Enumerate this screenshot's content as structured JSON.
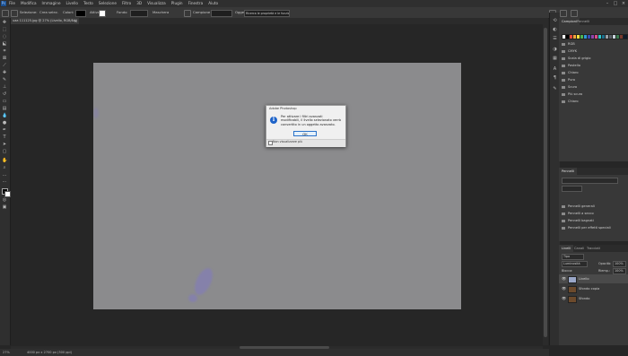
{
  "menubar": {
    "items": [
      "File",
      "Modifica",
      "Immagine",
      "Livello",
      "Testo",
      "Selezione",
      "Filtro",
      "3D",
      "Visualizza",
      "Plugin",
      "Finestra",
      "Aiuto"
    ],
    "logo": "Ps"
  },
  "options_bar": {
    "label_1": "Selezione:",
    "value_1": "Crea selez.",
    "label_2": "Colori:",
    "label_3": "Attiva",
    "label_4": "Fondo",
    "label_5": "Maschera",
    "label_6": "Campione",
    "label_7": "Oggetto",
    "search_text": "Ricerca le proprietà e le funzioni"
  },
  "document_tab": {
    "title": "uaa 111125.jpg @ 27% (Livello, RGB/8#)",
    "close": "×"
  },
  "dialog": {
    "title": "Adobe Photoshop",
    "message": "Per attivare i filtri avanzati modificabili, il livello selezionato verrà convertito in un oggetto avanzato.",
    "ok_label": "OK",
    "checkbox_label": "Non visualizzare più"
  },
  "panel_top": {
    "tabs": [
      "Campioni",
      "Pennelli"
    ],
    "folders": [
      "RGB",
      "CMYK",
      "Scala di grigio",
      "Pastello",
      "Chiaro",
      "Puro",
      "Scuro",
      "Più scuro",
      "Chiaro"
    ],
    "swatch_colors": [
      "#ffffff",
      "#000000",
      "#e84b3a",
      "#f2a33a",
      "#f5e33b",
      "#4fb24e",
      "#2e9ad6",
      "#3a4bb5",
      "#8e44ad",
      "#d94c8c",
      "#2fc6c8",
      "#1c6e8c",
      "#9aa0a6",
      "#5a5f66",
      "#c8d4dc",
      "#3a7a4e",
      "#7a3a2e",
      "#0f1a2a"
    ]
  },
  "panel_brushes": {
    "title": "Pennelli",
    "folders": [
      "Pennelli generali",
      "Pennelli a secco",
      "Pennelli bagnati",
      "Pennelli per effetti speciali"
    ]
  },
  "panel_layers": {
    "tabs": [
      "Livelli",
      "Canali",
      "Tracciati"
    ],
    "filter_label": "Tipo",
    "blend_mode": "Luminosità",
    "opacity_label": "Opacità:",
    "opacity_value": "100%",
    "lock_label": "Blocca:",
    "fill_label": "Riemp.:",
    "fill_value": "100%",
    "layers": [
      {
        "name": "Livello",
        "selected": true
      },
      {
        "name": "Sfondo copia",
        "selected": false
      },
      {
        "name": "Sfondo",
        "selected": false
      }
    ]
  },
  "status": {
    "zoom": "27%",
    "doc_info": "4000 px x 2700 px (300 ppi)"
  },
  "colors": {
    "app_bg": "#262626",
    "canvas": "#8b8b8d",
    "accent": "#1e63c9",
    "stain": "#7b6fe0"
  }
}
